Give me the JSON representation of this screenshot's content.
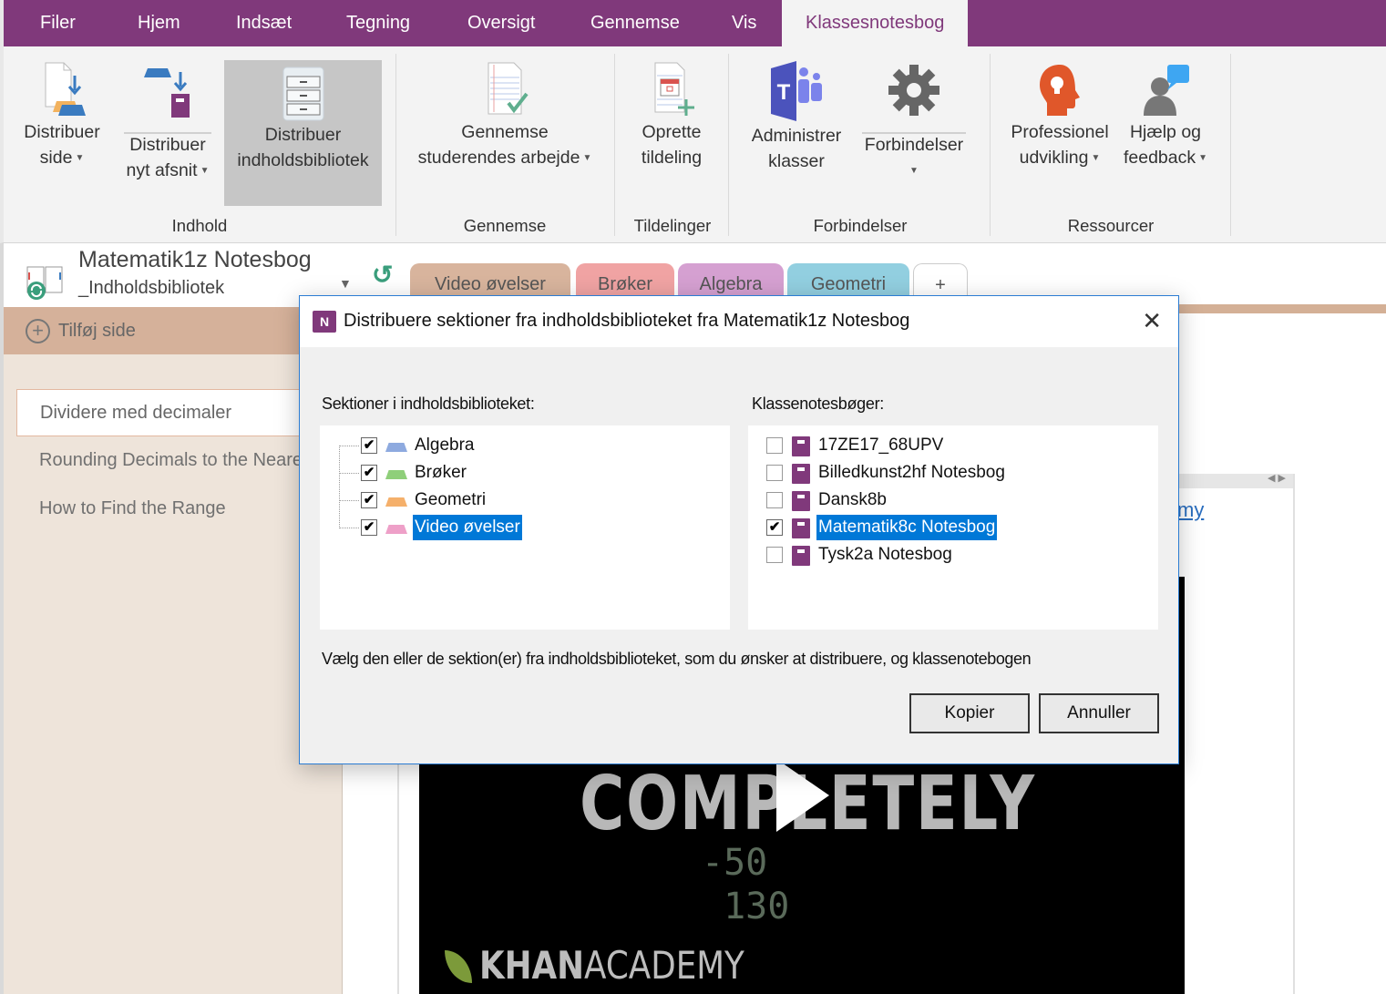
{
  "menu_tabs": [
    {
      "label": "Filer",
      "active": false
    },
    {
      "label": "Hjem",
      "active": false
    },
    {
      "label": "Indsæt",
      "active": false
    },
    {
      "label": "Tegning",
      "active": false
    },
    {
      "label": "Oversigt",
      "active": false
    },
    {
      "label": "Gennemse",
      "active": false
    },
    {
      "label": "Vis",
      "active": false
    },
    {
      "label": "Klassesnotesbog",
      "active": true
    }
  ],
  "ribbon": {
    "groups": {
      "indhold": "Indhold",
      "gennemse": "Gennemse",
      "tildelinger": "Tildelinger",
      "forbindelser": "Forbindelser",
      "ressourcer": "Ressourcer"
    },
    "buttons": {
      "distribuer_side": {
        "line1": "Distribuer",
        "line2": "side"
      },
      "distribuer_afsnit": {
        "line1": "Distribuer",
        "line2": "nyt afsnit"
      },
      "distribuer_bibliotek": {
        "line1": "Distribuer",
        "line2": "indholdsbibliotek"
      },
      "gennemse_arbejde": {
        "line1": "Gennemse",
        "line2": "studerendes arbejde"
      },
      "opret_tildeling": {
        "line1": "Oprette",
        "line2": "tildeling"
      },
      "administrer_klasser": {
        "line1": "Administrer",
        "line2": "klasser"
      },
      "forbindelser": {
        "line1": "Forbindelser"
      },
      "professionel": {
        "line1": "Professionel",
        "line2": "udvikling"
      },
      "hjaelp": {
        "line1": "Hjælp og",
        "line2": "feedback"
      }
    },
    "colors": {
      "brand": "#80397b",
      "teams": "#4b53bc",
      "orange": "#e0572a",
      "blue_bubble": "#3ea6f2"
    }
  },
  "notebook": {
    "title": "Matematik1z Notesbog",
    "subtitle": "_Indholdsbibliotek",
    "section_tabs": [
      {
        "label": "Video øvelser",
        "color": "#d8b49d",
        "active": true
      },
      {
        "label": "Brøker",
        "color": "#f0a3a3"
      },
      {
        "label": "Algebra",
        "color": "#d5a0d1"
      },
      {
        "label": "Geometri",
        "color": "#92cfe0"
      },
      {
        "label": "+",
        "color": "#ffffff"
      }
    ]
  },
  "pages": {
    "add_page": "Tilføj side",
    "items": [
      {
        "label": "Dividere med decimaler",
        "active": true
      },
      {
        "label": "Rounding Decimals to the Nearest",
        "active": false
      },
      {
        "label": "How to Find the Range",
        "active": false
      }
    ]
  },
  "canvas": {
    "link_fragment": "my",
    "video": {
      "headline": "COMPLETELY",
      "chalk_line1": "-50",
      "chalk_line2": "130",
      "brand_bold": "KHAN",
      "brand_rest": "ACADEMY"
    }
  },
  "dialog": {
    "title": "Distribuere sektioner fra indholdsbiblioteket fra Matematik1z Notesbog",
    "close": "✕",
    "sections_label": "Sektioner i indholdsbiblioteket:",
    "sections": [
      {
        "label": "Algebra",
        "checked": true,
        "color": "#8eaadf",
        "selected": false
      },
      {
        "label": "Brøker",
        "checked": true,
        "color": "#8fcf7a",
        "selected": false
      },
      {
        "label": "Geometri",
        "checked": true,
        "color": "#f5b06b",
        "selected": false
      },
      {
        "label": "Video øvelser",
        "checked": true,
        "color": "#eea0c8",
        "selected": true
      }
    ],
    "notebooks_label": "Klassenotesbøger:",
    "notebooks": [
      {
        "label": "17ZE17_68UPV",
        "checked": false,
        "selected": false
      },
      {
        "label": "Billedkunst2hf Notesbog",
        "checked": false,
        "selected": false
      },
      {
        "label": "Dansk8b",
        "checked": false,
        "selected": false
      },
      {
        "label": "Matematik8c Notesbog",
        "checked": true,
        "selected": true
      },
      {
        "label": "Tysk2a Notesbog",
        "checked": false,
        "selected": false
      }
    ],
    "hint": "Vælg den eller de sektion(er) fra indholdsbiblioteket, som du ønsker at distribuere, og klassenotebogen",
    "copy_button": "Kopier",
    "cancel_button": "Annuller",
    "check_glyph": "✔"
  }
}
